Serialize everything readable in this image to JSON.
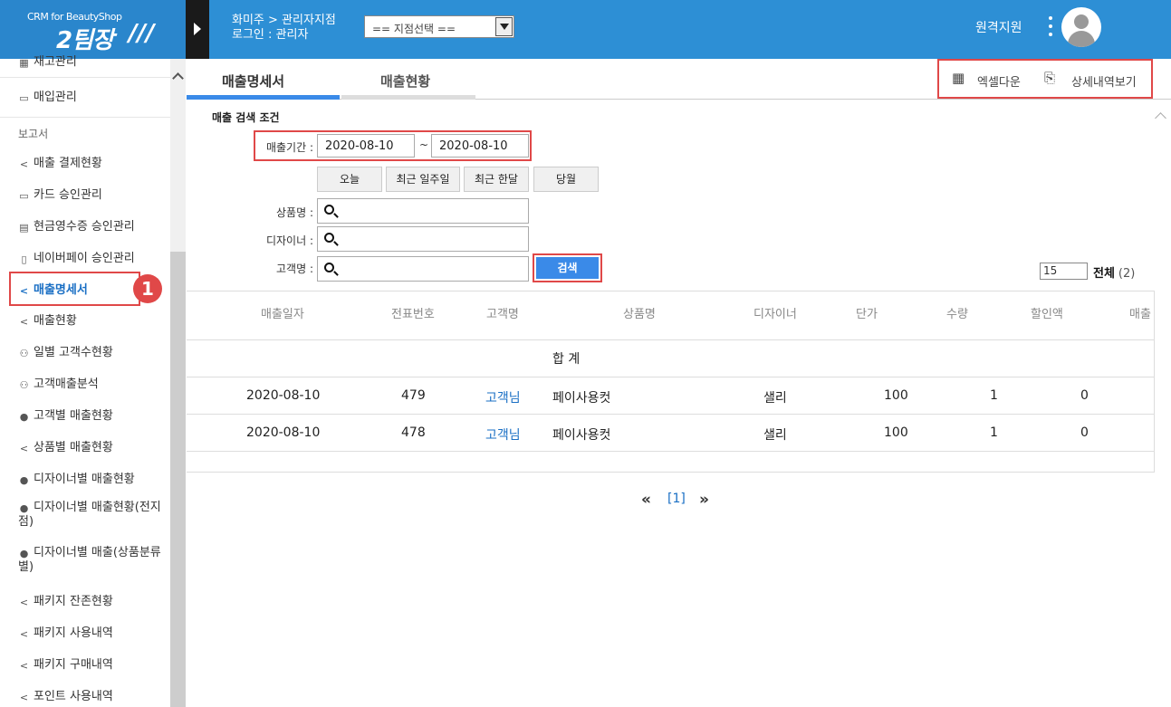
{
  "header": {
    "logo_sub": "CRM for BeautyShop",
    "logo_main": "2팀장",
    "logo_slash": "///",
    "breadcrumb": "화미주 > 관리자지점",
    "login": "로그인 : 관리자",
    "branch_select": "== 지점선택 ==",
    "remote_support": "원격지원"
  },
  "sidebar": {
    "top_partial": "재고관리",
    "purchase": "매입관리",
    "section": "보고서",
    "items": [
      {
        "label": "매출 결제현황",
        "icon": "share-icon"
      },
      {
        "label": "카드 승인관리",
        "icon": "card-icon"
      },
      {
        "label": "현금영수증 승인관리",
        "icon": "cash-icon"
      },
      {
        "label": "네이버페이 승인관리",
        "icon": "phone-icon"
      },
      {
        "label": "매출명세서",
        "icon": "share-icon"
      },
      {
        "label": "매출현황",
        "icon": "share-icon"
      },
      {
        "label": "일별 고객수현황",
        "icon": "people-icon"
      },
      {
        "label": "고객매출분석",
        "icon": "people-icon"
      },
      {
        "label": "고객별 매출현황",
        "icon": "person-icon"
      },
      {
        "label": "상품별 매출현황",
        "icon": "share-icon"
      },
      {
        "label": "디자이너별 매출현황",
        "icon": "person-icon"
      },
      {
        "label": "디자이너별 매출현황(전지",
        "label2": "점)",
        "icon": "person-icon"
      },
      {
        "label": "디자이너별 매출(상품분류",
        "label2": "별)",
        "icon": "person-icon"
      },
      {
        "label": "패키지 잔존현황",
        "icon": "share-icon"
      },
      {
        "label": "패키지 사용내역",
        "icon": "share-icon"
      },
      {
        "label": "패키지 구매내역",
        "icon": "share-icon"
      },
      {
        "label": "포인트 사용내역",
        "icon": "share-icon"
      }
    ],
    "badge": "1"
  },
  "tabs": {
    "statement": "매출명세서",
    "status": "매출현황"
  },
  "actions": {
    "excel": "엑셀다운",
    "detail": "상세내역보기"
  },
  "search": {
    "title": "매출 검색 조건",
    "period_label": "매출기간 :",
    "date_from": "2020-08-10",
    "tilde": "~",
    "date_to": "2020-08-10",
    "quick": [
      "오늘",
      "최근 일주일",
      "최근 한달",
      "당월"
    ],
    "product_label": "상품명 :",
    "designer_label": "디자이너 :",
    "customer_label": "고객명 :",
    "search_button": "검색",
    "per_page": "15",
    "total_label": "전체",
    "total_count": "(2)"
  },
  "table": {
    "columns": [
      "매출일자",
      "전표번호",
      "고객명",
      "상품명",
      "디자이너",
      "단가",
      "수량",
      "할인액",
      "매출"
    ],
    "sum_label": "합 계",
    "rows": [
      {
        "date": "2020-08-10",
        "no": "479",
        "customer": "고객님",
        "product": "페이사용컷",
        "designer": "샐리",
        "price": "100",
        "qty": "1",
        "discount": "0"
      },
      {
        "date": "2020-08-10",
        "no": "478",
        "customer": "고객님",
        "product": "페이사용컷",
        "designer": "샐리",
        "price": "100",
        "qty": "1",
        "discount": "0"
      }
    ]
  },
  "pager": {
    "prev": "«",
    "current": "[1]",
    "next": "»"
  },
  "colors": {
    "header_bg": "#2d8fd5",
    "highlight": "#e04848",
    "link": "#1a6fc4",
    "search_btn": "#3a8ae8"
  }
}
